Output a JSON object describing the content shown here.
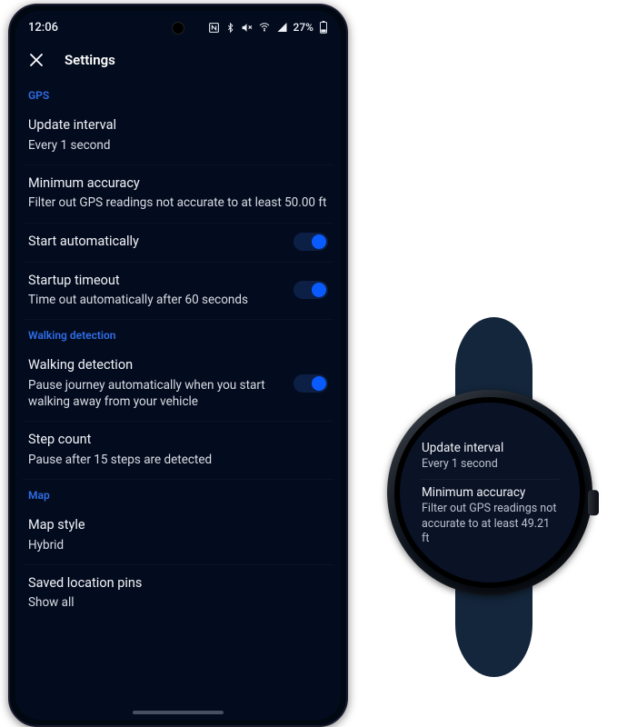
{
  "phone": {
    "status": {
      "time": "12:06",
      "battery": "27%"
    },
    "header": {
      "title": "Settings"
    },
    "sections": [
      {
        "id": "gps",
        "label": "GPS",
        "rows": [
          {
            "id": "update-interval",
            "title": "Update interval",
            "sub": "Every 1 second",
            "toggle": false
          },
          {
            "id": "min-accuracy",
            "title": "Minimum accuracy",
            "sub": "Filter out GPS readings not accurate to at least 50.00 ft",
            "toggle": false
          },
          {
            "id": "start-auto",
            "title": "Start automatically",
            "sub": null,
            "toggle": true
          },
          {
            "id": "startup-timeout",
            "title": "Startup timeout",
            "sub": "Time out automatically after 60 seconds",
            "toggle": true
          }
        ]
      },
      {
        "id": "walking",
        "label": "Walking detection",
        "rows": [
          {
            "id": "walking-detection",
            "title": "Walking detection",
            "sub": "Pause journey automatically when you start walking away from your vehicle",
            "toggle": true
          },
          {
            "id": "step-count",
            "title": "Step count",
            "sub": "Pause after 15 steps are detected",
            "toggle": false
          }
        ]
      },
      {
        "id": "map",
        "label": "Map",
        "rows": [
          {
            "id": "map-style",
            "title": "Map style",
            "sub": "Hybrid",
            "toggle": false
          },
          {
            "id": "saved-pins",
            "title": "Saved location pins",
            "sub": "Show all",
            "toggle": false
          }
        ]
      }
    ]
  },
  "watch": {
    "rows": [
      {
        "id": "update-interval",
        "title": "Update interval",
        "sub": "Every 1 second"
      },
      {
        "id": "min-accuracy",
        "title": "Minimum accuracy",
        "sub": "Filter out GPS readings not accurate to at least 49.21 ft"
      }
    ]
  },
  "colors": {
    "accent": "#0a5bff",
    "sectionHeader": "#2f6ee8",
    "phoneBg": "#030b1e",
    "watchBg": "#0a1226"
  }
}
